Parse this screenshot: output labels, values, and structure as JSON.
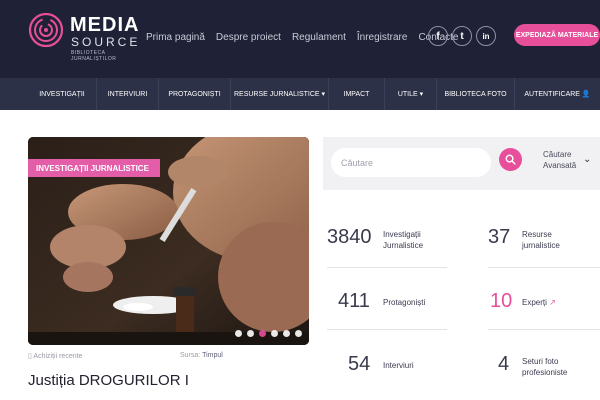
{
  "brand": {
    "name_line1": "MEDIA",
    "name_line2": "SOURCE",
    "tagline": "BIBLIOTECA JURNALIȘTILOR"
  },
  "top_nav": [
    {
      "label": "Prima pagină"
    },
    {
      "label": "Despre proiect"
    },
    {
      "label": "Regulament"
    },
    {
      "label": "Înregistrare"
    },
    {
      "label": "Contacte"
    }
  ],
  "social": {
    "facebook": "f",
    "twitter": "t",
    "linkedin": "in"
  },
  "cta_label": "EXPEDIAZĂ MATERIALE",
  "main_nav": [
    {
      "label": "INVESTIGAȚII"
    },
    {
      "label": "INTERVIURI"
    },
    {
      "label": "PROTAGONIȘTI"
    },
    {
      "label": "RESURSE JURNALISTICE ▾"
    },
    {
      "label": "IMPACT"
    },
    {
      "label": "UTILE ▾"
    },
    {
      "label": "BIBLIOTECA FOTO"
    },
    {
      "label": "AUTENTIFICARE 👤"
    }
  ],
  "hero": {
    "badge": "INVESTIGAȚII JURNALISTICE",
    "bookmark_label": "Achiziții recente",
    "source_prefix": "Sursa:",
    "source_name": "Timpul",
    "title": "Justiția DROGURILOR I"
  },
  "search": {
    "placeholder": "Căutare",
    "advanced_line1": "Căutare",
    "advanced_line2": "Avansată"
  },
  "stats": [
    {
      "value": "3840",
      "label_line1": "Investigații",
      "label_line2": "Jurnalistice"
    },
    {
      "value": "37",
      "label_line1": "Resurse",
      "label_line2": "jurnalistice"
    },
    {
      "value": "411",
      "label_line1": "Protagoniști",
      "label_line2": ""
    },
    {
      "value": "10",
      "label_line1": "Experți",
      "label_line2": ""
    },
    {
      "value": "54",
      "label_line1": "Interviuri",
      "label_line2": ""
    },
    {
      "value": "4",
      "label_line1": "Seturi foto",
      "label_line2": "profesioniste"
    }
  ],
  "colors": {
    "accent": "#e74f9b",
    "header_bg": "#1f2236",
    "nav_bg": "#2d3147"
  }
}
